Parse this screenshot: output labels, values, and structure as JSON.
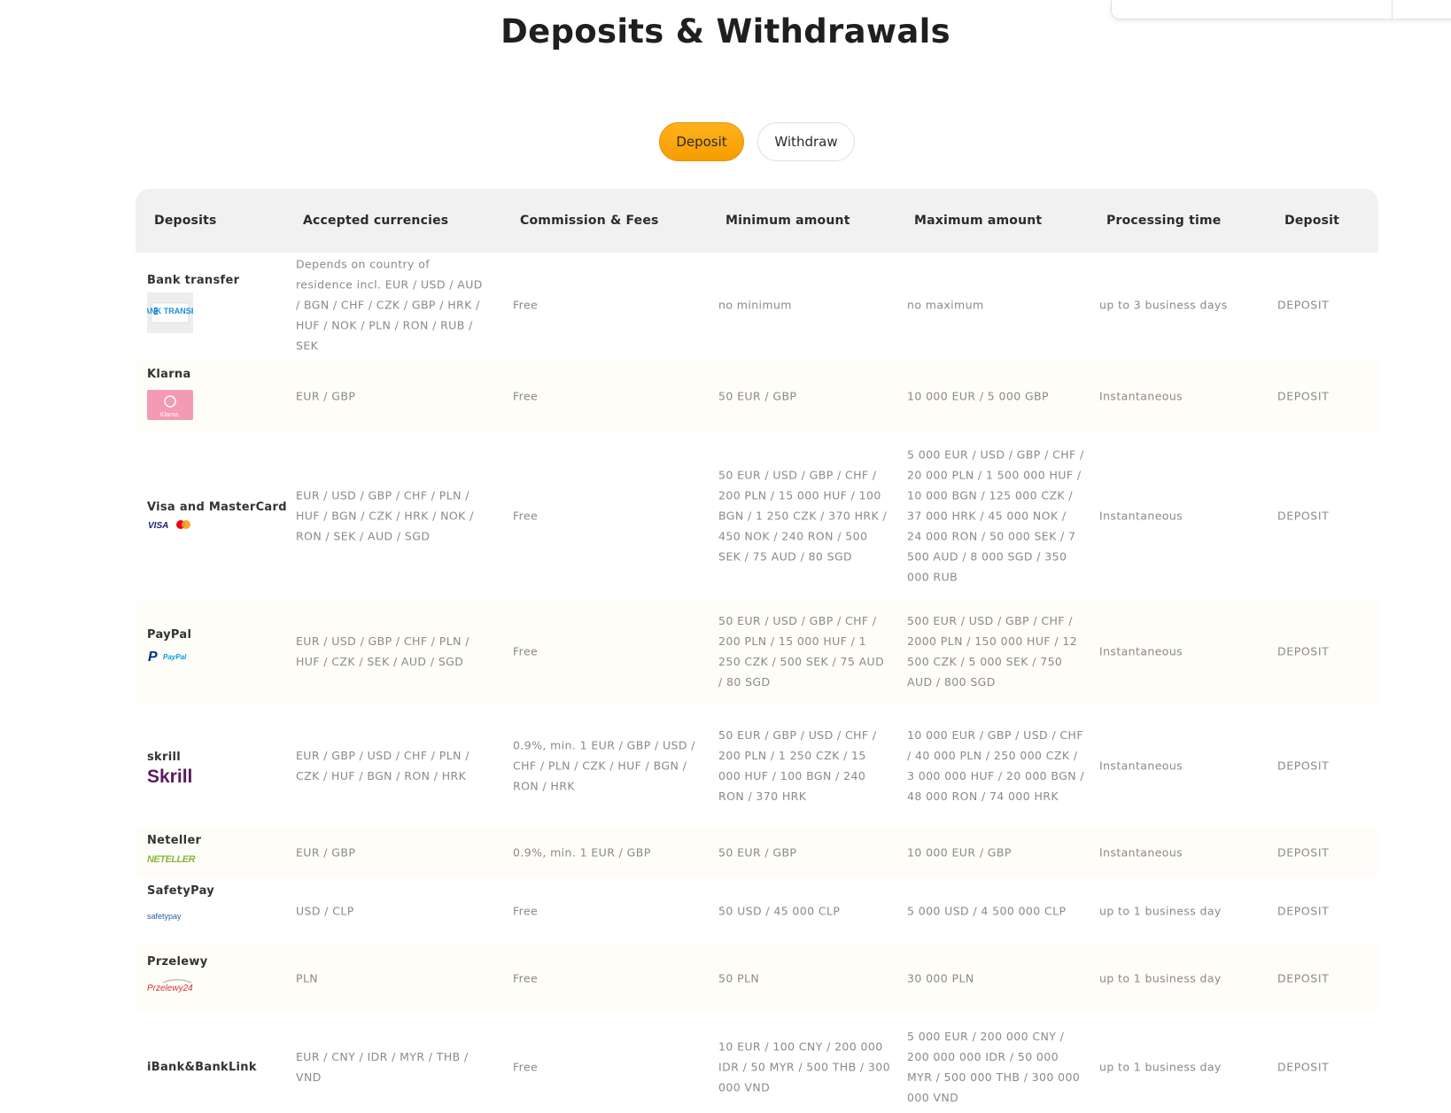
{
  "page": {
    "title": "Deposits & Withdrawals"
  },
  "tabs": [
    {
      "label": "Deposit",
      "active": true
    },
    {
      "label": "Withdraw",
      "active": false
    }
  ],
  "colors": {
    "accent": "#f7a600",
    "header_bg": "#f1f1f1",
    "alt_row_bg": "#fffdf7",
    "muted_text": "#8a8a8a"
  },
  "table": {
    "headers": [
      "Deposits",
      "Accepted currencies",
      "Commission & Fees",
      "Minimum amount",
      "Maximum amount",
      "Processing time",
      "Deposit"
    ],
    "rows": [
      {
        "method": "Bank transfer",
        "logo": "bank-transfer-logo",
        "logo_text": "BANK TRANSFER",
        "currencies": "Depends on country of residence incl. EUR / USD / AUD / BGN / CHF / CZK / GBP / HRK / HUF / NOK / PLN / RON / RUB / SEK",
        "fees": "Free",
        "min": "no minimum",
        "max": "no maximum",
        "time": "up to 3 business days",
        "action": "DEPOSIT"
      },
      {
        "method": "Klarna",
        "logo": "klarna-logo",
        "logo_text": "Klarna.",
        "currencies": "EUR / GBP",
        "fees": "Free",
        "min": "50 EUR / GBP",
        "max": "10 000 EUR / 5 000 GBP",
        "time": "Instantaneous",
        "action": "DEPOSIT"
      },
      {
        "method": "Visa and MasterCard",
        "logo": "visa-mastercard-logo",
        "logo_text": "VISA",
        "currencies": "EUR / USD / GBP / CHF / PLN / HUF / BGN / CZK / HRK / NOK / RON / SEK / AUD / SGD",
        "fees": "Free",
        "min": "50 EUR / USD / GBP / CHF / 200 PLN / 15 000 HUF / 100 BGN / 1 250 CZK / 370 HRK / 450 NOK / 240 RON / 500 SEK / 75 AUD / 80 SGD",
        "max": "5 000 EUR / USD / GBP / CHF / 20 000 PLN / 1 500 000 HUF / 10 000 BGN / 125 000 CZK / 37 000 HRK / 45 000 NOK / 24 000 RON / 50 000 SEK / 7 500 AUD / 8 000 SGD / 350 000 RUB",
        "time": "Instantaneous",
        "action": "DEPOSIT"
      },
      {
        "method": "PayPal",
        "logo": "paypal-logo",
        "logo_text": "PayPal",
        "currencies": "EUR / USD / GBP / CHF / PLN / HUF / CZK / SEK / AUD / SGD",
        "fees": "Free",
        "min": "50 EUR / USD / GBP / CHF / 200 PLN / 15 000 HUF / 1 250 CZK / 500 SEK / 75 AUD / 80 SGD",
        "max": "500 EUR / USD / GBP / CHF / 2000 PLN / 150 000 HUF / 12 500 CZK / 5 000 SEK / 750 AUD / 800 SGD",
        "time": "Instantaneous",
        "action": "DEPOSIT"
      },
      {
        "method": "skrill",
        "logo": "skrill-logo",
        "logo_text": "Skrill",
        "currencies": "EUR / GBP / USD / CHF / PLN / CZK / HUF / BGN / RON / HRK",
        "fees": "0.9%, min. 1 EUR / GBP / USD / CHF / PLN / CZK / HUF / BGN / RON / HRK",
        "min": "50 EUR / GBP / USD / CHF / 200 PLN / 1 250 CZK / 15 000 HUF / 100 BGN / 240 RON / 370 HRK",
        "max": "10 000 EUR / GBP / USD / CHF / 40 000 PLN / 250 000 CZK / 3 000 000 HUF / 20 000 BGN / 48 000 RON / 74 000 HRK",
        "time": "Instantaneous",
        "action": "DEPOSIT"
      },
      {
        "method": "Neteller",
        "logo": "neteller-logo",
        "logo_text": "NETELLER",
        "currencies": "EUR / GBP",
        "fees": "0.9%, min. 1 EUR / GBP",
        "min": "50 EUR / GBP",
        "max": "10 000 EUR / GBP",
        "time": "Instantaneous",
        "action": "DEPOSIT"
      },
      {
        "method": "SafetyPay",
        "logo": "safetypay-logo",
        "logo_text": "safetypay",
        "currencies": "USD / CLP",
        "fees": "Free",
        "min": "50 USD / 45 000 CLP",
        "max": "5 000 USD / 4 500 000 CLP",
        "time": "up to 1 business day",
        "action": "DEPOSIT"
      },
      {
        "method": "Przelewy",
        "logo": "przelewy24-logo",
        "logo_text": "Przelewy24",
        "currencies": "PLN",
        "fees": "Free",
        "min": "50 PLN",
        "max": "30 000 PLN",
        "time": "up to 1 business day",
        "action": "DEPOSIT"
      },
      {
        "method": "iBank&BankLink",
        "logo": "",
        "currencies": "EUR / CNY / IDR / MYR / THB / VND",
        "fees": "Free",
        "min": "10 EUR / 100 CNY / 200 000 IDR / 50 MYR / 500 THB / 300 000 VND",
        "max": "5 000 EUR / 200 000 CNY / 200 000 000 IDR / 50 000 MYR / 500 000 THB / 300 000 000 VND",
        "time": "up to 1 business day",
        "action": "DEPOSIT"
      }
    ]
  }
}
